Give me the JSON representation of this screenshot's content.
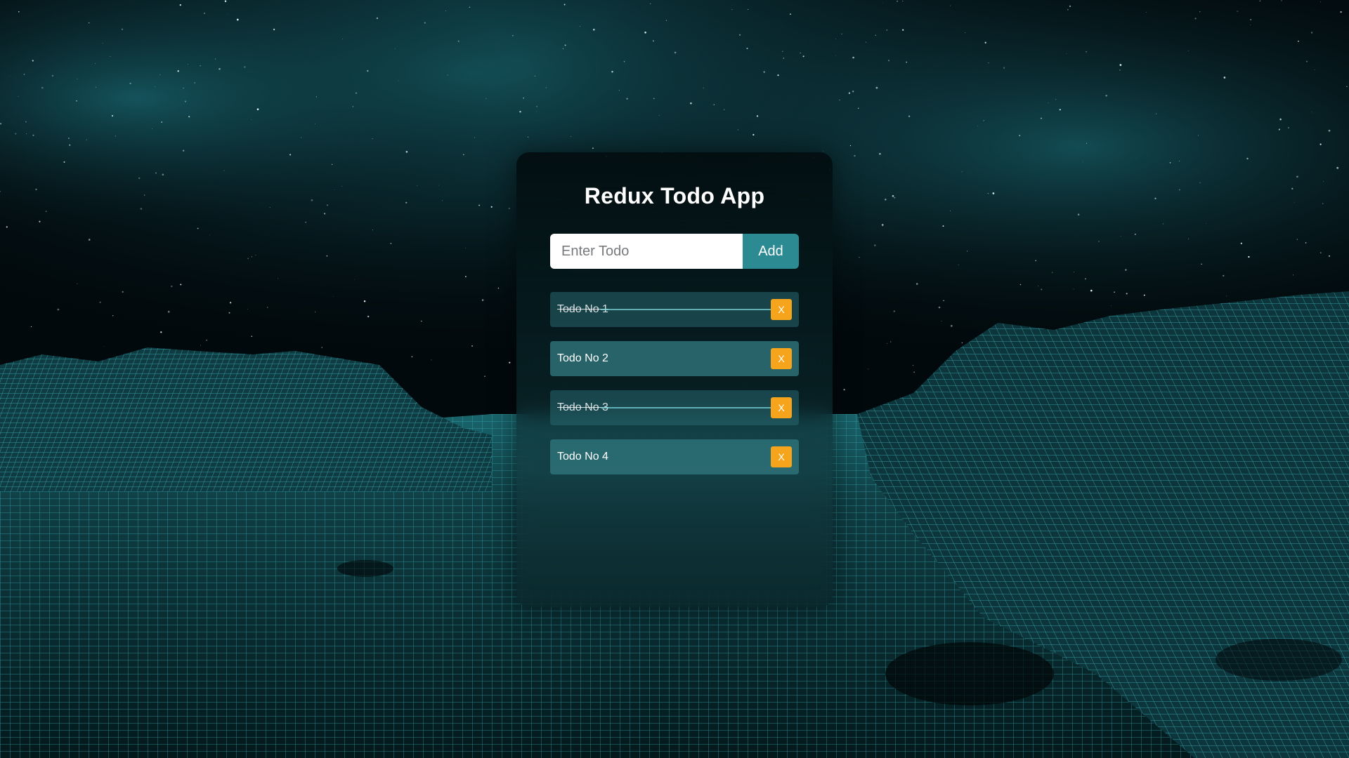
{
  "app": {
    "title": "Redux Todo App"
  },
  "input": {
    "placeholder": "Enter Todo",
    "value": ""
  },
  "buttons": {
    "add_label": "Add",
    "delete_label": "X"
  },
  "todos": [
    {
      "text": "Todo No 1",
      "completed": true
    },
    {
      "text": "Todo No 2",
      "completed": false
    },
    {
      "text": "Todo No 3",
      "completed": true
    },
    {
      "text": "Todo No 4",
      "completed": false
    }
  ],
  "colors": {
    "accent": "#2c8a92",
    "delete": "#f6a41c",
    "text": "#ffffff",
    "background_sky": "#02090c",
    "wireframe": "#3fb8c0"
  },
  "icons": {
    "background": "wireframe-landscape-starfield"
  }
}
